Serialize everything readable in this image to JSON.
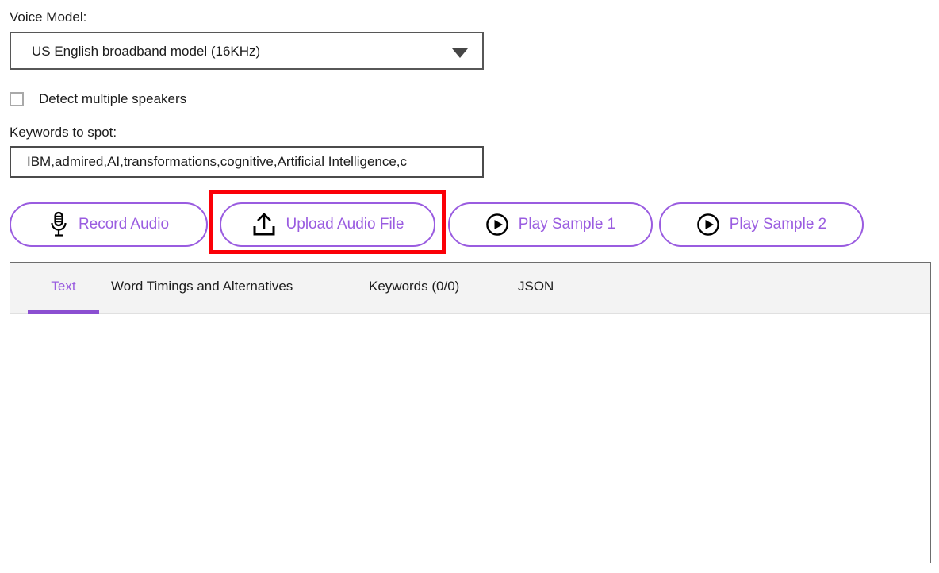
{
  "voice_model": {
    "label": "Voice Model:",
    "selected": "US English broadband model (16KHz)",
    "arrow_icon": "chevron-down-icon"
  },
  "options": {
    "detect_speakers_label": "Detect multiple speakers",
    "detect_speakers_checked": "false"
  },
  "keywords": {
    "label": "Keywords to spot:",
    "value": "IBM,admired,AI,transformations,cognitive,Artificial Intelligence,c"
  },
  "buttons": [
    {
      "id": "record",
      "label": "Record Audio",
      "icon": "microphone-icon"
    },
    {
      "id": "upload",
      "label": "Upload Audio File",
      "icon": "upload-icon"
    },
    {
      "id": "sample1",
      "label": "Play Sample 1",
      "icon": "play-circle-icon"
    },
    {
      "id": "sample2",
      "label": "Play Sample 2",
      "icon": "play-circle-icon"
    }
  ],
  "tabs": [
    {
      "label": "Text",
      "active": "true"
    },
    {
      "label": "Word Timings and Alternatives",
      "active": "false"
    },
    {
      "label": "Keywords (0/0)",
      "active": "false"
    },
    {
      "label": "JSON",
      "active": "false"
    }
  ],
  "results": {
    "text": ""
  },
  "annotation": {
    "highlight_target": "Upload Audio File",
    "highlight_color": "#fb0007"
  },
  "colors": {
    "accent_purple": "#9a5ce0",
    "tab_underline": "#8b4fd1",
    "tabbar_bg": "#f3f3f3",
    "border_dark": "#575757",
    "panel_border": "#6d6d6d"
  }
}
